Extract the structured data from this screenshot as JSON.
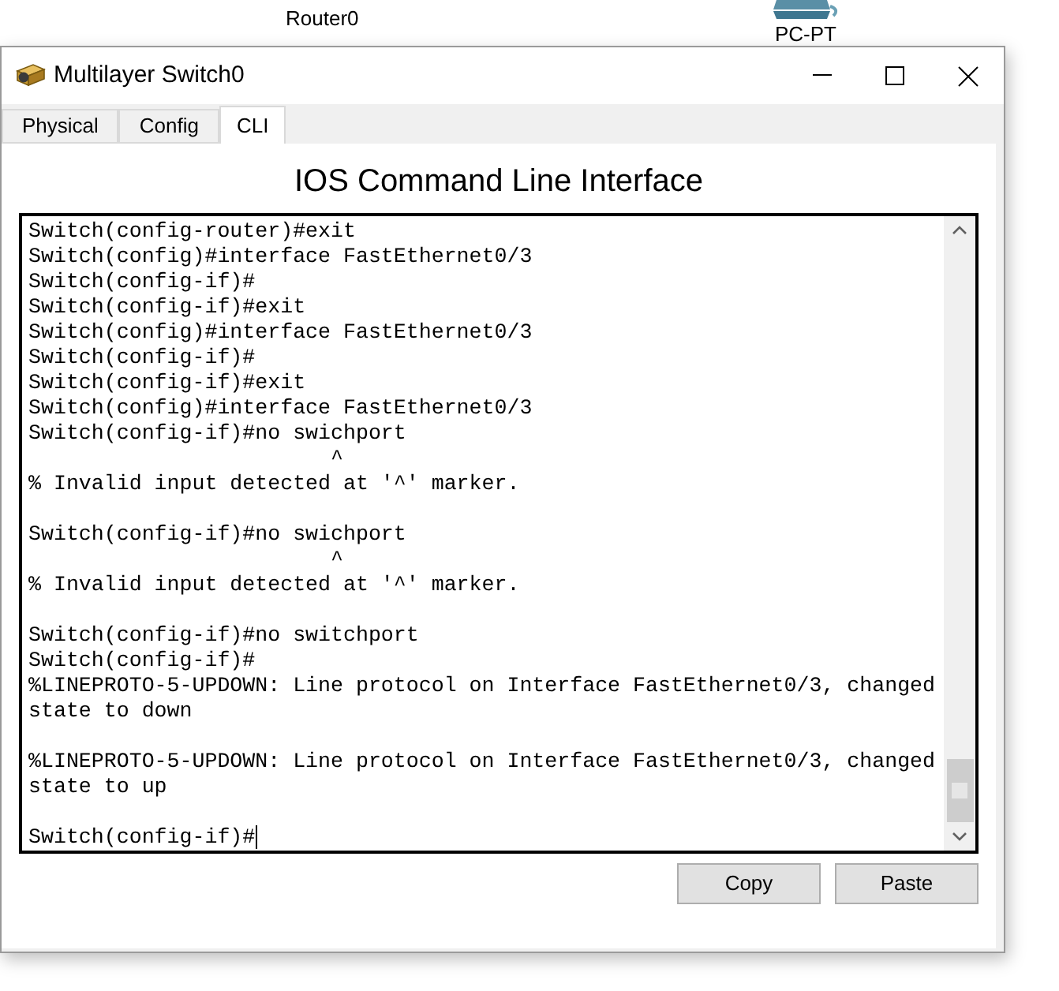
{
  "background": {
    "labels": [
      "Router0",
      "PC-PT"
    ]
  },
  "window": {
    "title": "Multilayer Switch0"
  },
  "tabs": [
    {
      "label": "Physical",
      "selected": false
    },
    {
      "label": "Config",
      "selected": false
    },
    {
      "label": "CLI",
      "selected": true
    }
  ],
  "heading": "IOS Command Line Interface",
  "terminal": {
    "lines": [
      {
        "kind": "text",
        "text": "Switch(config-router)#exit"
      },
      {
        "kind": "text",
        "text": "Switch(config)#interface FastEthernet0/3"
      },
      {
        "kind": "text",
        "text": "Switch(config-if)#"
      },
      {
        "kind": "text",
        "text": "Switch(config-if)#exit"
      },
      {
        "kind": "text",
        "text": "Switch(config)#interface FastEthernet0/3"
      },
      {
        "kind": "text",
        "text": "Switch(config-if)#"
      },
      {
        "kind": "text",
        "text": "Switch(config-if)#exit"
      },
      {
        "kind": "text",
        "text": "Switch(config)#interface FastEthernet0/3"
      },
      {
        "kind": "text",
        "text": "Switch(config-if)#no swichport"
      },
      {
        "kind": "text",
        "text": "                        ^"
      },
      {
        "kind": "text",
        "text": "% Invalid input detected at '^' marker."
      },
      {
        "kind": "blank"
      },
      {
        "kind": "text",
        "text": "Switch(config-if)#no swichport"
      },
      {
        "kind": "text",
        "text": "                        ^"
      },
      {
        "kind": "text",
        "text": "% Invalid input detected at '^' marker."
      },
      {
        "kind": "blank"
      },
      {
        "kind": "text",
        "text": "Switch(config-if)#no switchport"
      },
      {
        "kind": "text",
        "text": "Switch(config-if)#"
      },
      {
        "kind": "text",
        "text": "%LINEPROTO-5-UPDOWN: Line protocol on Interface FastEthernet0/3, changed"
      },
      {
        "kind": "text",
        "text": "state to down"
      },
      {
        "kind": "blank"
      },
      {
        "kind": "text",
        "text": "%LINEPROTO-5-UPDOWN: Line protocol on Interface FastEthernet0/3, changed"
      },
      {
        "kind": "text",
        "text": "state to up"
      },
      {
        "kind": "blank"
      },
      {
        "kind": "prompt",
        "text": "Switch(config-if)#"
      }
    ]
  },
  "buttons": [
    "Copy",
    "Paste"
  ]
}
